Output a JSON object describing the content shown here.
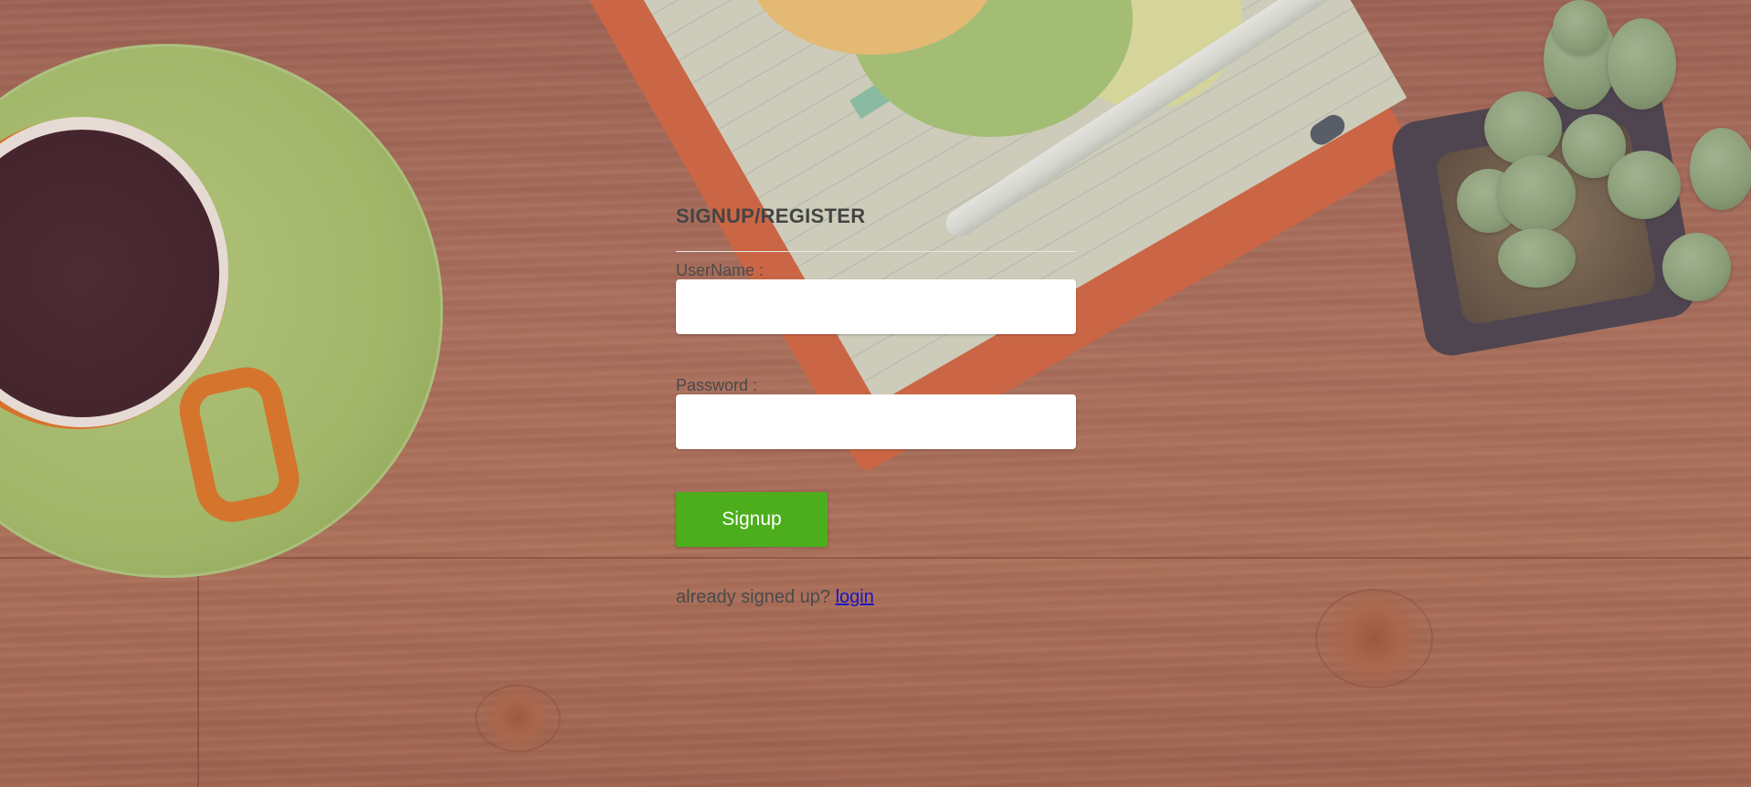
{
  "form": {
    "title": "SIGNUP/REGISTER",
    "username_label": "UserName :",
    "username_value": "",
    "password_label": "Password :",
    "password_value": "",
    "submit_label": "Signup",
    "login_prompt": "already signed up?",
    "login_link": "login"
  },
  "colors": {
    "button": "#4cae1c",
    "link": "#1515c8",
    "text": "#444444"
  },
  "background": {
    "description_icon": "desk-photo-background"
  }
}
